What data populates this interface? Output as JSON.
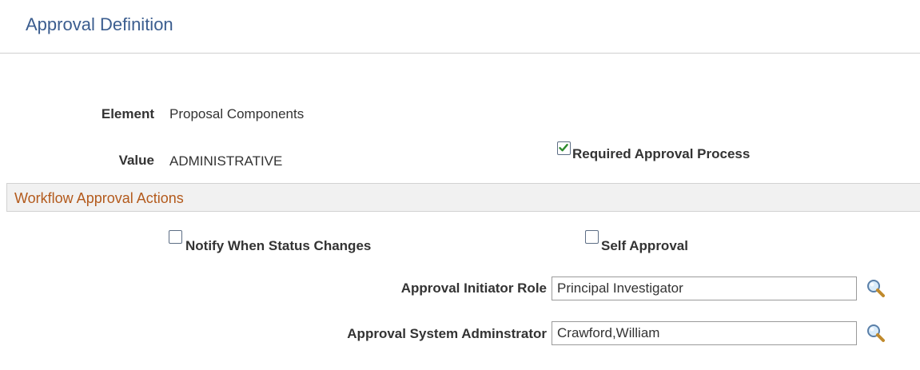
{
  "page": {
    "title": "Approval Definition"
  },
  "details": {
    "element_label": "Element",
    "element_value": "Proposal Components",
    "value_label": "Value",
    "value_value": "ADMINISTRATIVE",
    "required_approval": {
      "label": "Required Approval Process",
      "checked": true
    }
  },
  "workflow": {
    "section_title": "Workflow Approval Actions",
    "notify_status": {
      "label": "Notify When Status Changes",
      "checked": false
    },
    "self_approval": {
      "label": "Self Approval",
      "checked": false
    },
    "initiator_role": {
      "label": "Approval Initiator Role",
      "value": "Principal Investigator",
      "icon": "magnifier-lookup-icon"
    },
    "system_admin": {
      "label": "Approval System Adminstrator",
      "value": "Crawford,William",
      "icon": "magnifier-lookup-icon"
    }
  },
  "colors": {
    "title": "#3b5d8f",
    "section_title": "#b35a1c",
    "checkmark": "#2e8b2e"
  }
}
